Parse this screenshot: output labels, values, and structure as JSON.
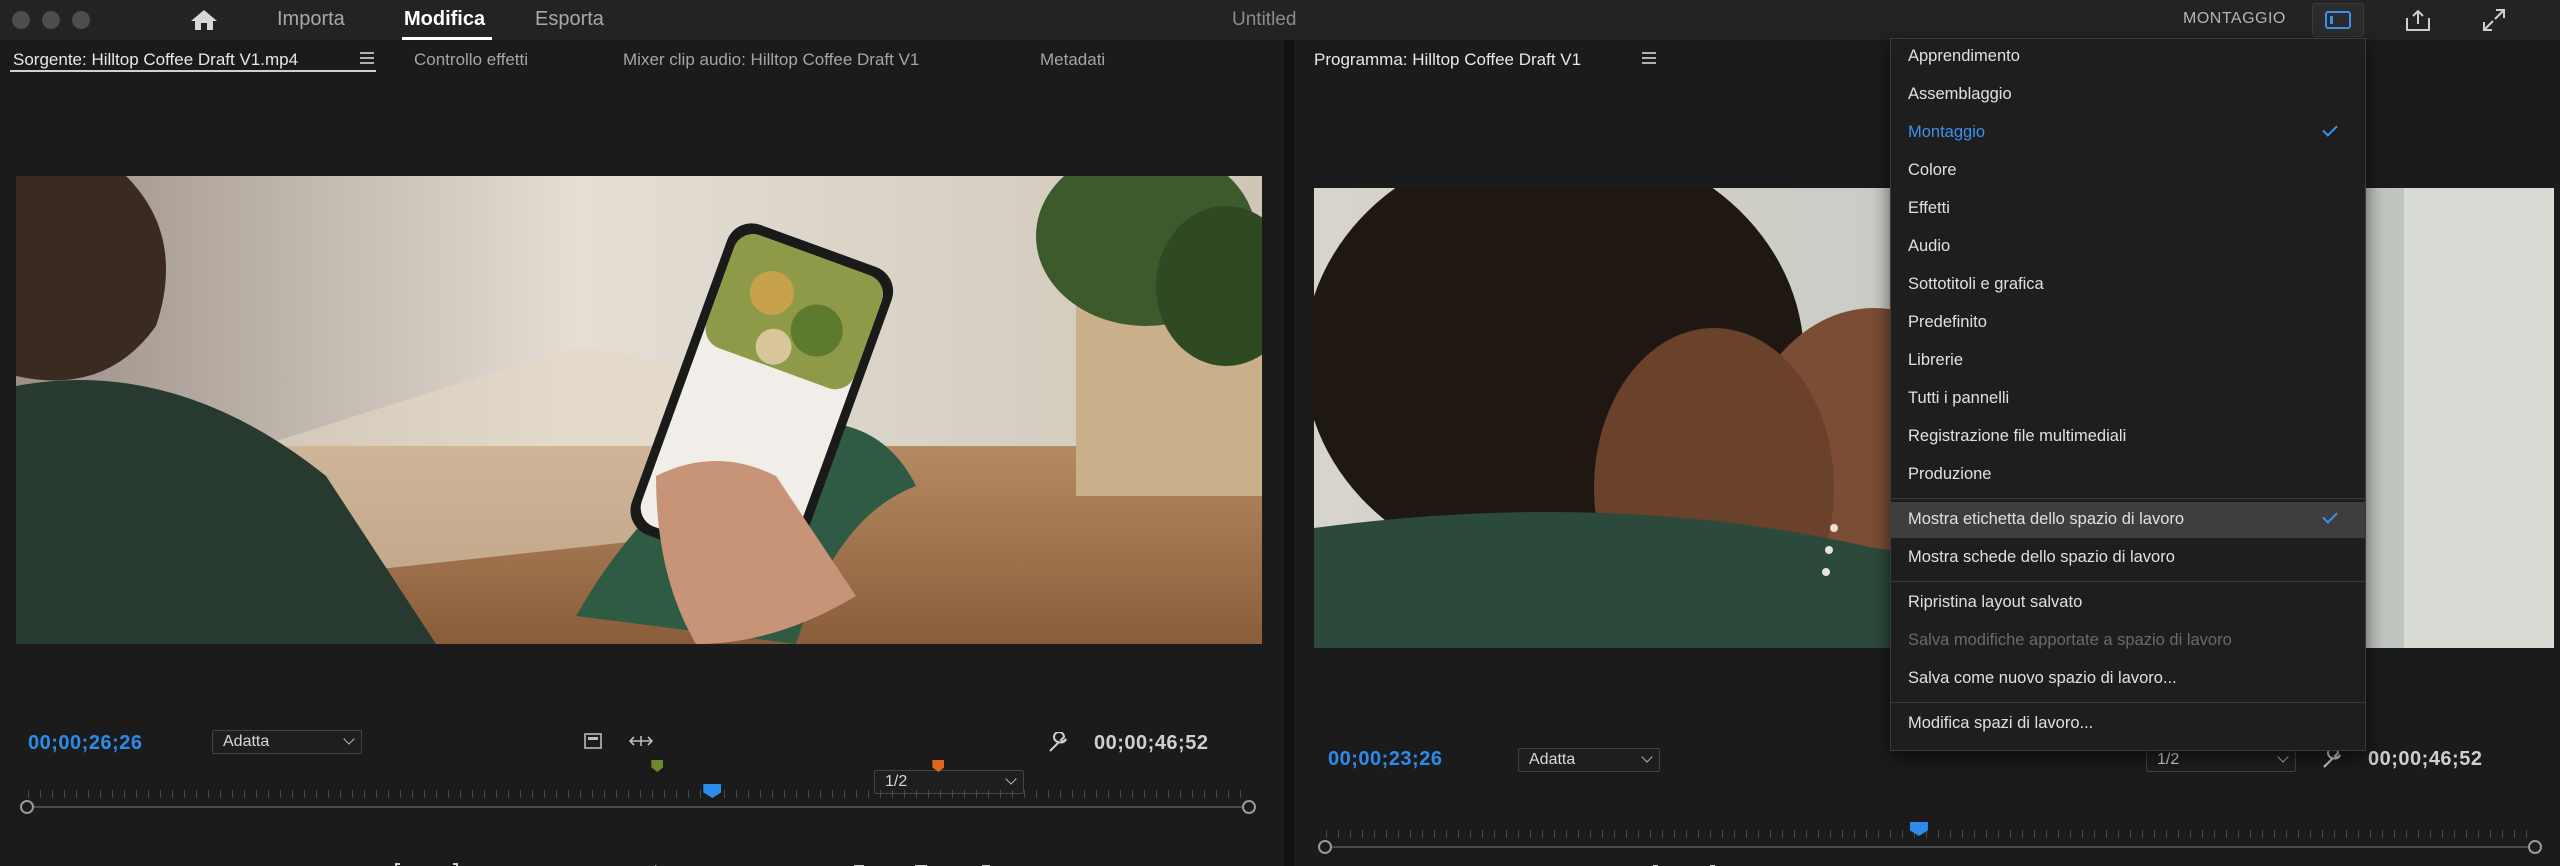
{
  "nav": {
    "tabs": [
      {
        "label": "Importa"
      },
      {
        "label": "Modifica"
      },
      {
        "label": "Esporta"
      }
    ],
    "title": "Untitled",
    "workspace_label": "MONTAGGIO"
  },
  "source": {
    "tabs": [
      {
        "label": "Sorgente: Hilltop Coffee Draft V1.mp4"
      },
      {
        "label": "Controllo effetti"
      },
      {
        "label": "Mixer clip audio: Hilltop Coffee Draft V1"
      },
      {
        "label": "Metadati"
      }
    ],
    "timecode_current": "00;00;26;26",
    "fit": "Adatta",
    "resolution": "1/2",
    "timecode_duration": "00;00;46;52",
    "playhead": 0.56,
    "marker_green": 0.515,
    "marker_orange": 0.745
  },
  "program": {
    "tab": "Programma: Hilltop Coffee Draft V1",
    "timecode_current": "00;00;23;26",
    "fit": "Adatta",
    "resolution": "1/2",
    "timecode_duration": "00;00;46;52",
    "playhead": 0.49
  },
  "workspace_menu": {
    "items": [
      {
        "label": "Apprendimento",
        "state": "normal"
      },
      {
        "label": "Assemblaggio",
        "state": "normal"
      },
      {
        "label": "Montaggio",
        "state": "selected"
      },
      {
        "label": "Colore",
        "state": "normal"
      },
      {
        "label": "Effetti",
        "state": "normal"
      },
      {
        "label": "Audio",
        "state": "normal"
      },
      {
        "label": "Sottotitoli e grafica",
        "state": "normal"
      },
      {
        "label": "Predefinito",
        "state": "normal"
      },
      {
        "label": "Librerie",
        "state": "normal"
      },
      {
        "label": "Tutti i pannelli",
        "state": "normal"
      },
      {
        "label": "Registrazione file multimediali",
        "state": "normal"
      },
      {
        "label": "Produzione",
        "state": "normal"
      }
    ],
    "options": [
      {
        "label": "Mostra etichetta dello spazio di lavoro",
        "state": "checked-highlight"
      },
      {
        "label": "Mostra schede dello spazio di lavoro",
        "state": "normal"
      }
    ],
    "layout": [
      {
        "label": "Ripristina layout salvato",
        "state": "normal"
      },
      {
        "label": "Salva modifiche apportate a spazio di lavoro",
        "state": "disabled"
      },
      {
        "label": "Salva come nuovo spazio di lavoro...",
        "state": "normal"
      }
    ],
    "edit": {
      "label": "Modifica spazi di lavoro...",
      "state": "normal"
    }
  },
  "icons": {
    "home": "home-icon",
    "workspaces": "workspaces-icon",
    "share": "share-icon",
    "fullscreen": "fullscreen-icon"
  },
  "colors": {
    "accent": "#2d8ceb",
    "marker_green": "#6f8a2a",
    "marker_orange": "#e0661e"
  }
}
